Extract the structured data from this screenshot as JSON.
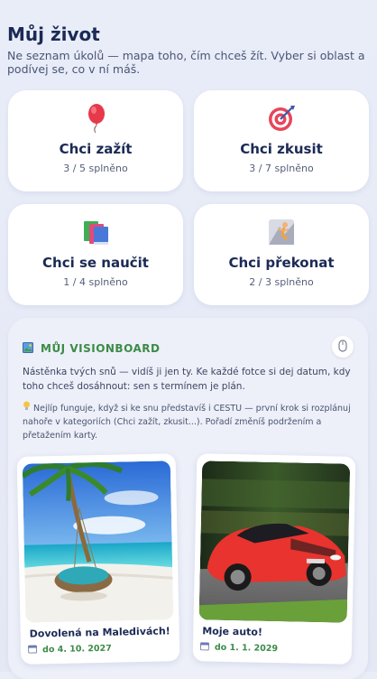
{
  "header": {
    "title": "Můj život",
    "subtitle": "Ne seznam úkolů — mapa toho, čím chceš žít. Vyber si oblast a podívej se, co v ní máš."
  },
  "categories": [
    {
      "label": "Chci zažít",
      "count": "3 / 5 splněno",
      "icon": "balloon-icon"
    },
    {
      "label": "Chci zkusit",
      "count": "3 / 7 splněno",
      "icon": "target-icon"
    },
    {
      "label": "Chci se naučit",
      "count": "1 / 4 splněno",
      "icon": "books-icon"
    },
    {
      "label": "Chci překonat",
      "count": "2 / 3 splněno",
      "icon": "climber-icon"
    }
  ],
  "visionboard": {
    "title": "MŮJ VISIONBOARD",
    "description": "Nástěnka tvých snů — vidíš ji jen ty. Ke každé fotce si dej datum, kdy toho chceš dosáhnout: sen s termínem je plán.",
    "tip": "Nejlíp funguje, když si ke snu představíš i CESTU — první krok si rozplánuj nahoře v kategoriích (Chci zažít, zkusit...). Pořadí změníš podržením a přetažením karty.",
    "cards": [
      {
        "title": "Dovolená na Maledivách!",
        "date": "do 4. 10. 2027"
      },
      {
        "title": "Moje auto!",
        "date": "do 1. 1. 2029"
      }
    ]
  },
  "colors": {
    "accent_green": "#3b8b47",
    "title_navy": "#1b2a55"
  }
}
